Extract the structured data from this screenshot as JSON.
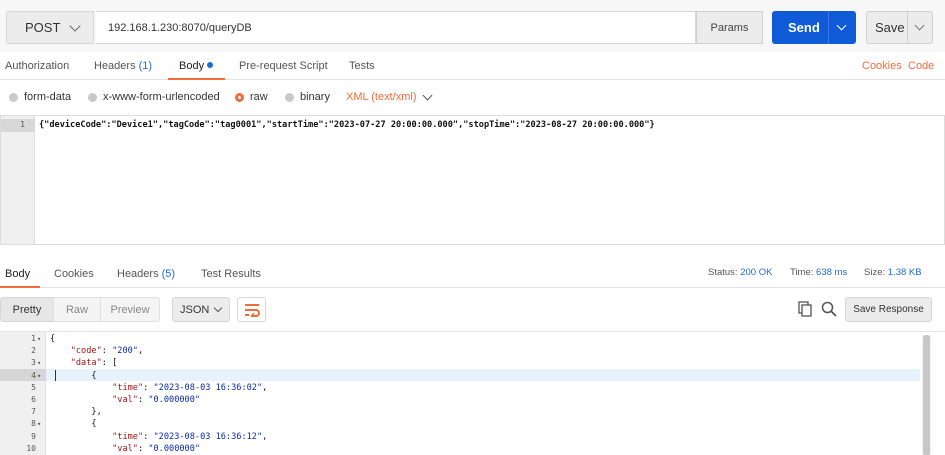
{
  "request": {
    "method": "POST",
    "url": "192.168.1.230:8070/queryDB",
    "params_label": "Params",
    "send_label": "Send",
    "save_label": "Save"
  },
  "request_tabs": {
    "authorization": "Authorization",
    "headers": "Headers",
    "headers_count": "(1)",
    "body": "Body",
    "pre_request": "Pre-request Script",
    "tests": "Tests",
    "cookies": "Cookies",
    "code": "Code"
  },
  "body_types": {
    "form_data": "form-data",
    "urlencoded": "x-www-form-urlencoded",
    "raw": "raw",
    "binary": "binary",
    "format": "XML (text/xml)",
    "selected": "raw"
  },
  "request_body": {
    "line_number": "1",
    "text": "{\"deviceCode\":\"Device1\",\"tagCode\":\"tag0001\",\"startTime\":\"2023-07-27 20:00:00.000\",\"stopTime\":\"2023-08-27 20:00:00.000\"}"
  },
  "response_tabs": {
    "body": "Body",
    "cookies": "Cookies",
    "headers": "Headers",
    "headers_count": "(5)",
    "test_results": "Test Results"
  },
  "response_meta": {
    "status_label": "Status:",
    "status_value": "200 OK",
    "time_label": "Time:",
    "time_value": "638 ms",
    "size_label": "Size:",
    "size_value": "1.38 KB"
  },
  "response_toolbar": {
    "pretty": "Pretty",
    "raw": "Raw",
    "preview": "Preview",
    "format": "JSON",
    "save_response": "Save Response"
  },
  "response_body": {
    "lines": [
      {
        "n": "1",
        "fold": "▾",
        "text": "{"
      },
      {
        "n": "2",
        "fold": "",
        "text": "    \"code\": \"200\","
      },
      {
        "n": "3",
        "fold": "▾",
        "text": "    \"data\": ["
      },
      {
        "n": "4",
        "fold": "▾",
        "text": "        {"
      },
      {
        "n": "5",
        "fold": "",
        "text": "            \"time\": \"2023-08-03 16:36:02\","
      },
      {
        "n": "6",
        "fold": "",
        "text": "            \"val\": \"0.000000\""
      },
      {
        "n": "7",
        "fold": "",
        "text": "        },"
      },
      {
        "n": "8",
        "fold": "▾",
        "text": "        {"
      },
      {
        "n": "9",
        "fold": "",
        "text": "            \"time\": \"2023-08-03 16:36:12\","
      },
      {
        "n": "10",
        "fold": "",
        "text": "            \"val\": \"0.000000\""
      }
    ]
  },
  "colors": {
    "accent_orange": "#f26b3a",
    "send_blue": "#0f5bd7",
    "count_blue": "#1f6bd8"
  },
  "icons": {
    "method_chevron": "chevron-down-icon",
    "send_chevron": "chevron-down-icon",
    "save_chevron": "chevron-down-icon",
    "wrap": "wrap-lines-icon",
    "copy": "copy-icon",
    "search": "search-icon"
  }
}
